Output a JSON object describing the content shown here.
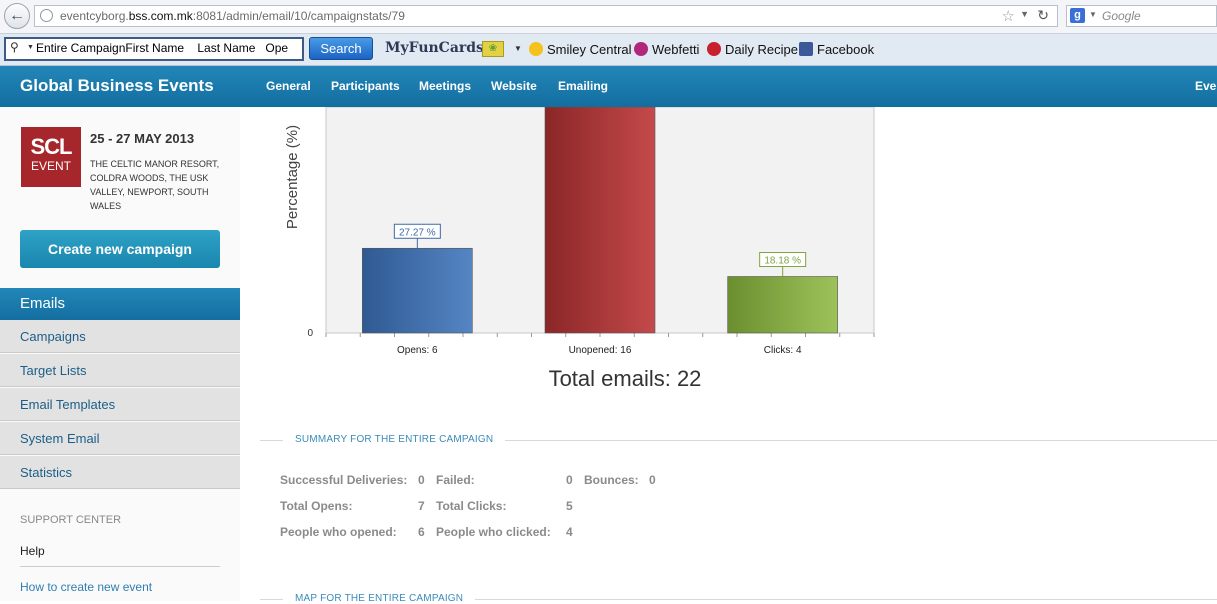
{
  "browser": {
    "url_prefix": "eventcyborg.",
    "url_domain": "bss.com.mk",
    "url_suffix": ":8081/admin/email/10/campaignstats/79",
    "search_engine": "Google",
    "search_placeholder": "Google"
  },
  "toolbar": {
    "search_value": "Entire CampaignFirst Name    Last Name   Ope",
    "search_button": "Search",
    "bookmarks": [
      {
        "label": "MyFunCards"
      },
      {
        "label": "Smiley Central"
      },
      {
        "label": "Webfetti"
      },
      {
        "label": "Daily Recipe"
      },
      {
        "label": "Facebook"
      }
    ]
  },
  "header": {
    "brand": "Global Business Events",
    "nav": [
      "General",
      "Participants",
      "Meetings",
      "Website",
      "Emailing"
    ],
    "right": "Even"
  },
  "sidebar": {
    "logo_line1": "SCL",
    "logo_line2": "EVENT",
    "event_date": "25 - 27 MAY 2013",
    "event_location": "THE CELTIC MANOR RESORT, COLDRA WOODS, THE USK VALLEY, NEWPORT, SOUTH WALES",
    "create_button": "Create new campaign",
    "active_section": "Emails",
    "items": [
      "Campaigns",
      "Target Lists",
      "Email Templates",
      "System Email",
      "Statistics"
    ],
    "support_title": "SUPPORT CENTER",
    "help": "Help",
    "howto": "How to create new event"
  },
  "chart_data": {
    "type": "bar",
    "categories": [
      "Opens: 6",
      "Unopened: 16",
      "Clicks: 4"
    ],
    "values": [
      27.27,
      72.73,
      18.18
    ],
    "data_labels": [
      "27.27 %",
      "",
      "18.18 %"
    ],
    "colors": [
      "#3f6aa6",
      "#a33334",
      "#7fa341"
    ],
    "ylabel": "Percentage (%)",
    "y_tick": "0",
    "ylim": [
      0,
      72.73
    ],
    "caption": "Total emails: 22"
  },
  "summary": {
    "title": "SUMMARY FOR THE ENTIRE CAMPAIGN",
    "rows": [
      {
        "l1": "Successful Deliveries:",
        "v1": "0",
        "l2": "Failed:",
        "v2": "0",
        "l3": "Bounces:",
        "v3": "0"
      },
      {
        "l1": "Total Opens:",
        "v1": "7",
        "l2": "Total Clicks:",
        "v2": "5"
      },
      {
        "l1": "People who opened:",
        "v1": "6",
        "l2": "People who clicked:",
        "v2": "4"
      }
    ]
  },
  "map": {
    "title": "MAP FOR THE ENTIRE CAMPAIGN"
  }
}
